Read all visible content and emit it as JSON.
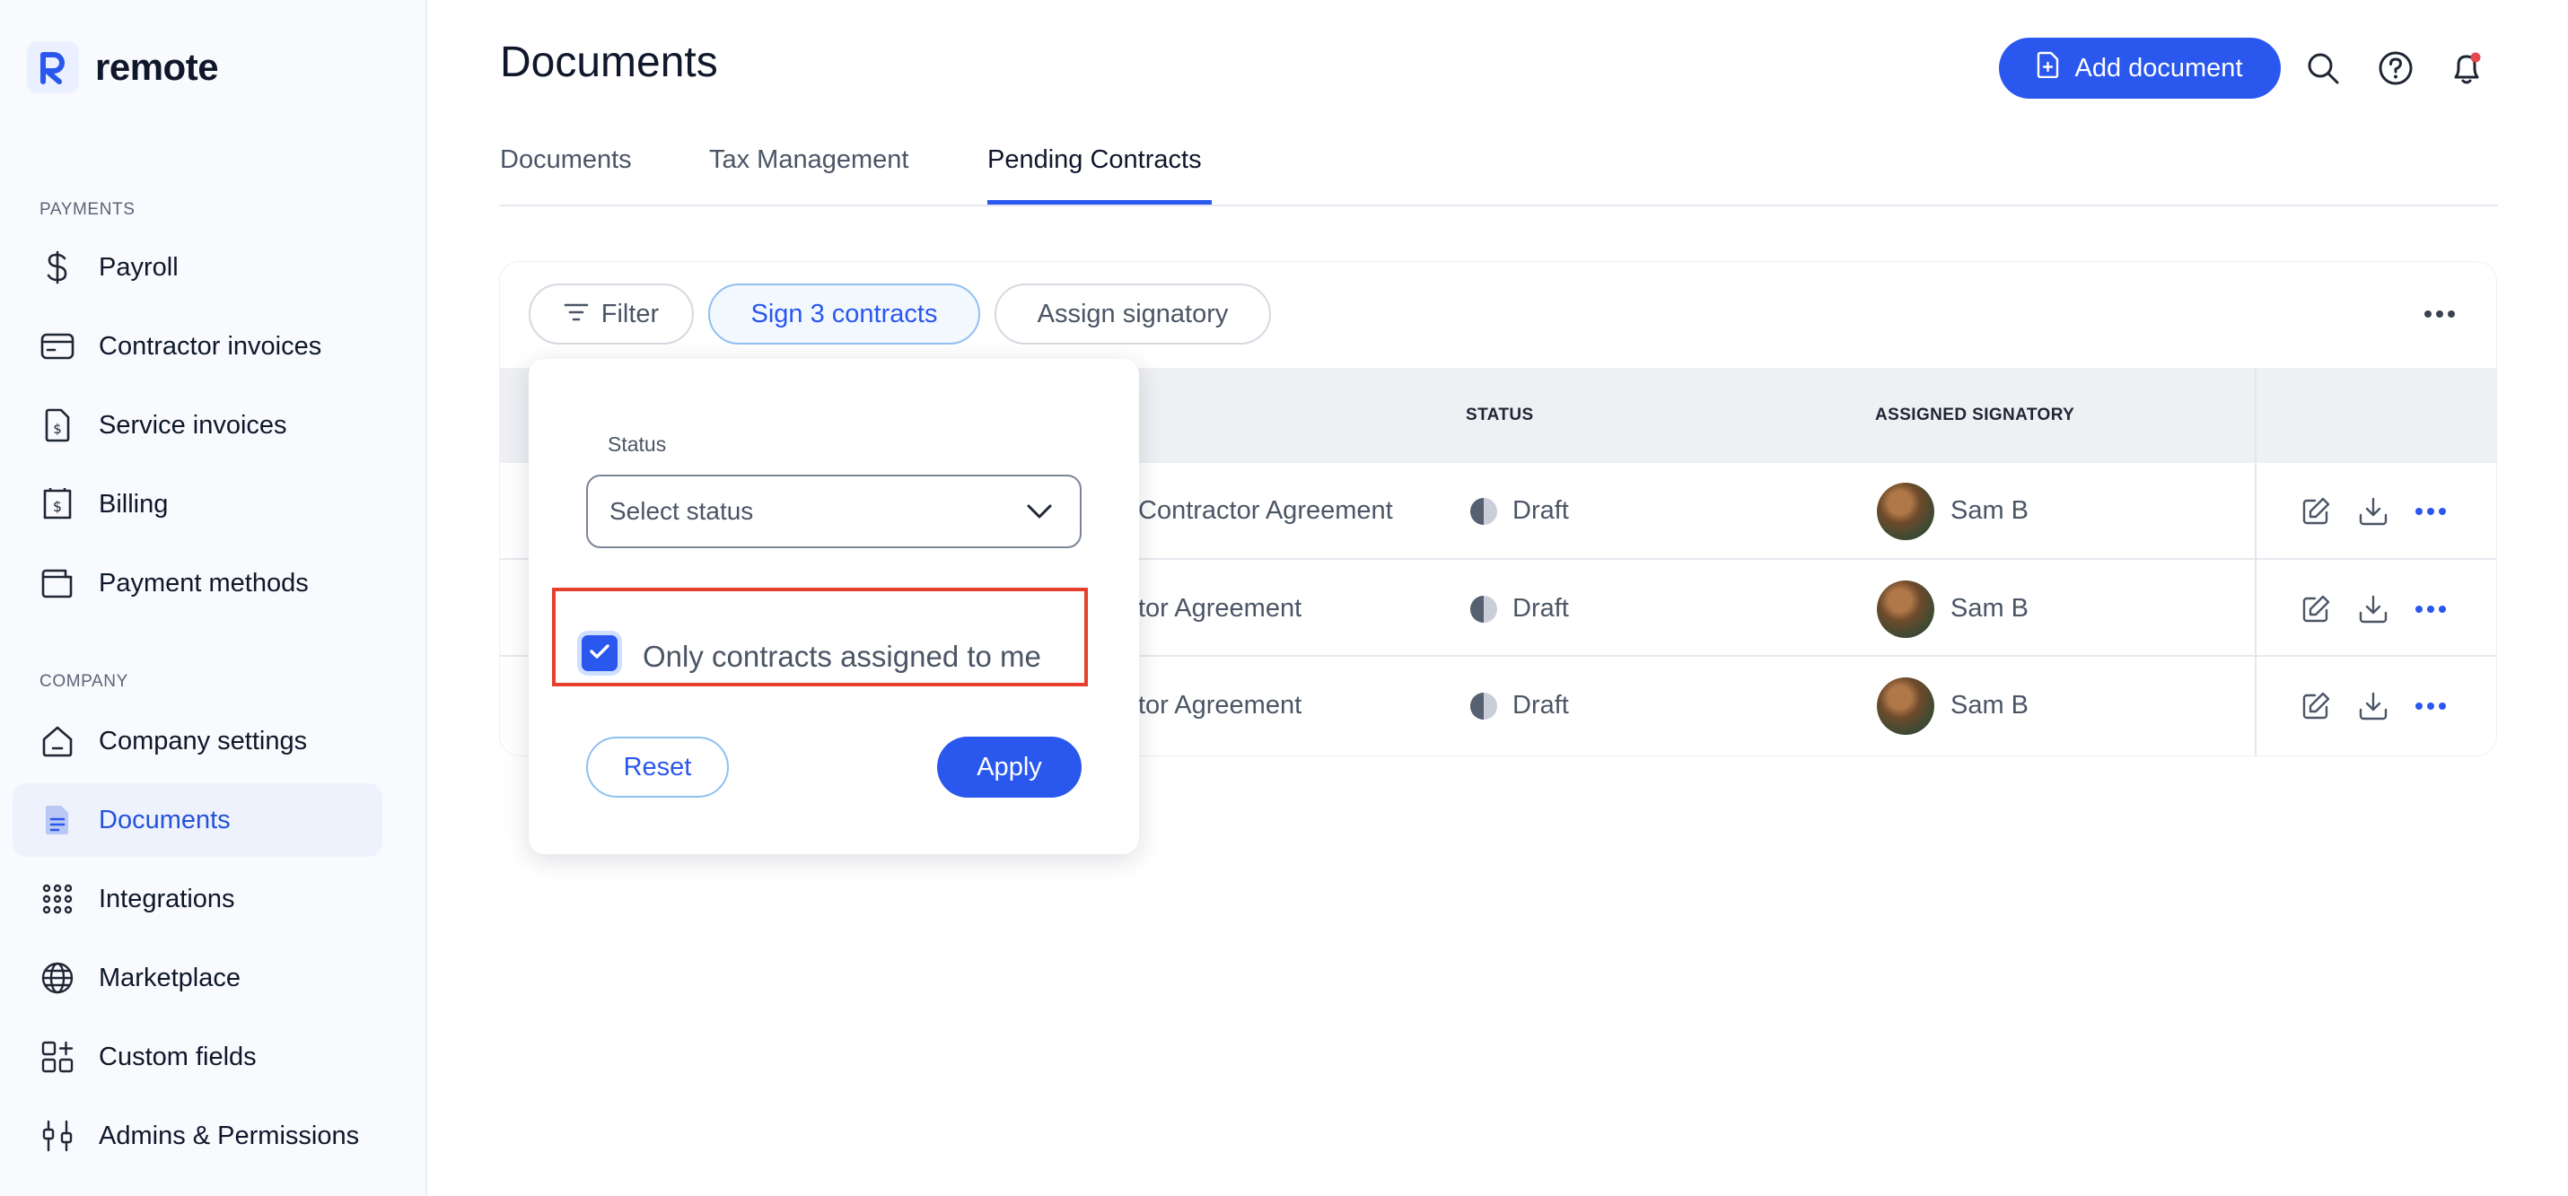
{
  "brand": {
    "name": "remote"
  },
  "sidebar": {
    "payments_label": "PAYMENTS",
    "company_label": "COMPANY",
    "payments_items": [
      {
        "label": "Payroll",
        "icon": "dollar-icon"
      },
      {
        "label": "Contractor invoices",
        "icon": "card-icon"
      },
      {
        "label": "Service invoices",
        "icon": "invoice-icon"
      },
      {
        "label": "Billing",
        "icon": "billing-icon"
      },
      {
        "label": "Payment methods",
        "icon": "wallet-icon"
      }
    ],
    "company_items": [
      {
        "label": "Company settings",
        "icon": "home-icon"
      },
      {
        "label": "Documents",
        "icon": "document-icon",
        "active": true
      },
      {
        "label": "Integrations",
        "icon": "grid-icon"
      },
      {
        "label": "Marketplace",
        "icon": "globe-icon"
      },
      {
        "label": "Custom fields",
        "icon": "add-fields-icon"
      },
      {
        "label": "Admins & Permissions",
        "icon": "sliders-icon"
      }
    ]
  },
  "header": {
    "title": "Documents",
    "add_document_label": "Add document",
    "icons": [
      "search-icon",
      "help-icon",
      "bell-icon"
    ]
  },
  "tabs": [
    {
      "label": "Documents"
    },
    {
      "label": "Tax Management"
    },
    {
      "label": "Pending Contracts",
      "active": true
    }
  ],
  "toolbar": {
    "filter_label": "Filter",
    "sign_label": "Sign 3 contracts",
    "assign_label": "Assign signatory"
  },
  "table": {
    "columns": [
      "STATUS",
      "ASSIGNED SIGNATORY"
    ],
    "rows": [
      {
        "document": "Contractor Agreement",
        "status": "Draft",
        "signatory": "Sam B"
      },
      {
        "document": "tor Agreement",
        "status": "Draft",
        "signatory": "Sam B"
      },
      {
        "document": "tor Agreement",
        "status": "Draft",
        "signatory": "Sam B"
      }
    ]
  },
  "filter_popover": {
    "status_label": "Status",
    "status_placeholder": "Select status",
    "only_mine_label": "Only contracts assigned to me",
    "only_mine_checked": true,
    "reset_label": "Reset",
    "apply_label": "Apply"
  },
  "colors": {
    "accent": "#2a57ee",
    "highlight": "#e6402d",
    "notification": "#e5484d"
  }
}
